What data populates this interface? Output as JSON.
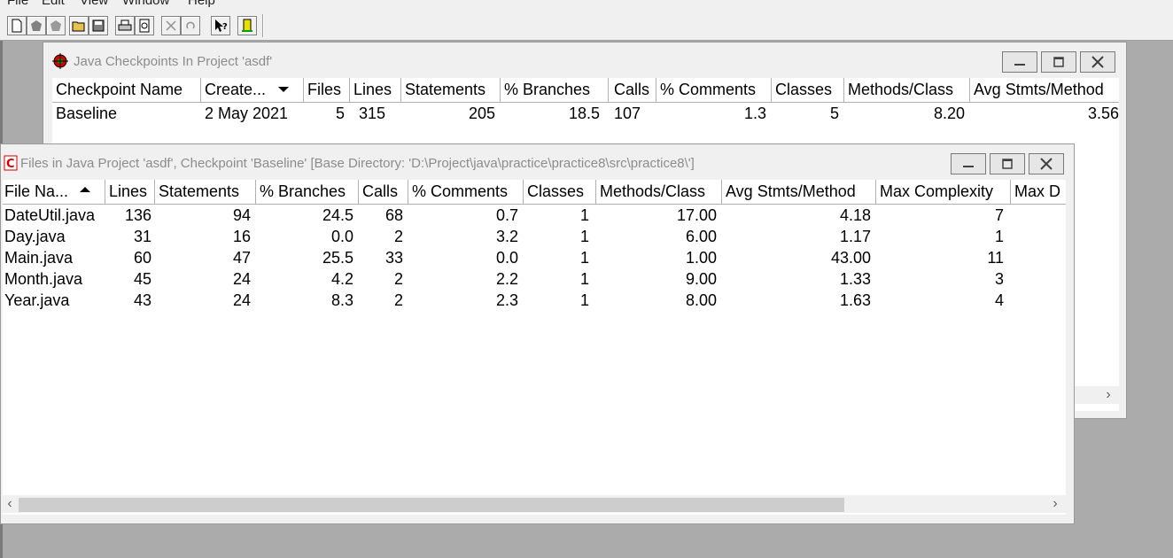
{
  "menu": {
    "file": "File",
    "edit": "Edit",
    "view": "View",
    "window": "Window",
    "help": "Help"
  },
  "toolbar": {
    "new": "new-document-icon",
    "record": "record-icon",
    "record2": "record-disabled-icon",
    "open": "open-folder-icon",
    "save": "save-icon",
    "print": "print-icon",
    "preview": "print-preview-icon",
    "delete": "delete-icon",
    "undo": "undo-icon",
    "whats_this": "whats-this-help-icon",
    "exit": "exit-icon"
  },
  "checkpoints_window": {
    "title": "Java Checkpoints In Project 'asdf'",
    "columns": [
      "Checkpoint Name",
      "Create...",
      "Files",
      "Lines",
      "Statements",
      "% Branches",
      "Calls",
      "% Comments",
      "Classes",
      "Methods/Class",
      "Avg Stmts/Method"
    ],
    "rows": [
      [
        "Baseline",
        "2 May 2021",
        "5",
        "315",
        "205",
        "18.5",
        "107",
        "1.3",
        "5",
        "8.20",
        "3.56"
      ]
    ]
  },
  "files_window": {
    "title": "Files in Java Project 'asdf', Checkpoint 'Baseline'  [Base Directory: 'D:\\Project\\java\\practice\\practice8\\src\\practice8\\']",
    "columns": [
      "File Na...",
      "Lines",
      "Statements",
      "% Branches",
      "Calls",
      "% Comments",
      "Classes",
      "Methods/Class",
      "Avg Stmts/Method",
      "Max Complexity",
      "Max D"
    ],
    "rows": [
      [
        "DateUtil.java",
        "136",
        "94",
        "24.5",
        "68",
        "0.7",
        "1",
        "17.00",
        "4.18",
        "7"
      ],
      [
        "Day.java",
        "31",
        "16",
        "0.0",
        "2",
        "3.2",
        "1",
        "6.00",
        "1.17",
        "1"
      ],
      [
        "Main.java",
        "60",
        "47",
        "25.5",
        "33",
        "0.0",
        "1",
        "1.00",
        "43.00",
        "11"
      ],
      [
        "Month.java",
        "45",
        "24",
        "4.2",
        "2",
        "2.2",
        "1",
        "9.00",
        "1.33",
        "3"
      ],
      [
        "Year.java",
        "43",
        "24",
        "8.3",
        "2",
        "2.3",
        "1",
        "8.00",
        "1.63",
        "4"
      ]
    ]
  }
}
